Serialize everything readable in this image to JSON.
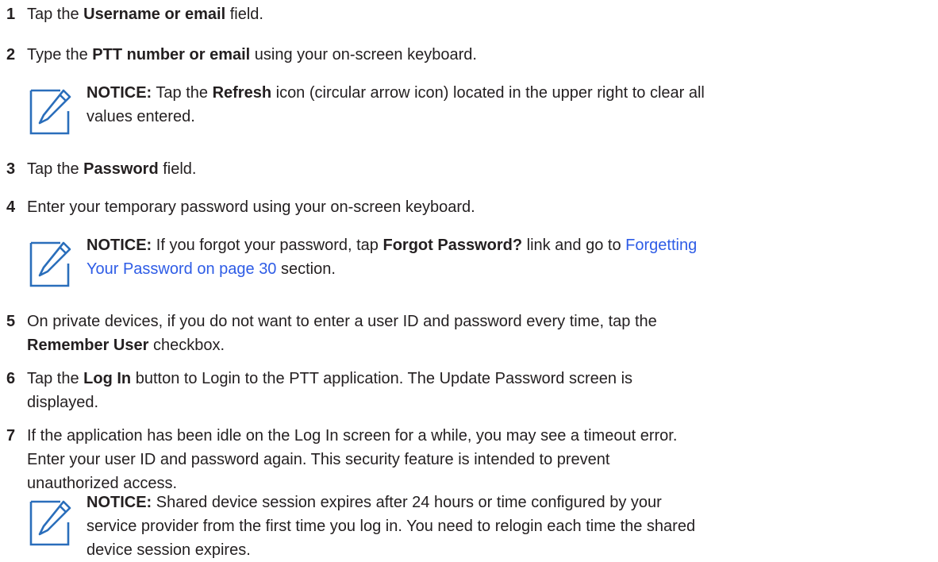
{
  "steps": [
    {
      "num": "1",
      "pre": "Tap the ",
      "bold": "Username or email",
      "post": " field."
    },
    {
      "num": "2",
      "pre": "Type the ",
      "bold": "PTT number or email",
      "post": " using your on-screen keyboard."
    },
    {
      "num": "3",
      "pre": "Tap the ",
      "bold": "Password",
      "post": " field."
    },
    {
      "num": "4",
      "text": "Enter your temporary password using your on-screen keyboard."
    },
    {
      "num": "5",
      "line1": "On private devices, if you do not want to enter a user ID and password every time, tap the",
      "bold": "Remember User",
      "post": " checkbox."
    },
    {
      "num": "6",
      "pre": "Tap the ",
      "bold": "Log In",
      "post": " button to Login to the PTT application. The Update Password screen is",
      "line2": "displayed."
    },
    {
      "num": "7",
      "line1": "If the application has been idle on the Log In screen for a while, you may see a timeout error.",
      "line2": "Enter your user ID and password again. This security feature is intended to prevent",
      "line3": "unauthorized access."
    }
  ],
  "notices": [
    {
      "label": "NOTICE:",
      "pre": " Tap the ",
      "bold": "Refresh",
      "post": " icon (circular arrow icon) located in the upper right to clear all",
      "line2": "values entered."
    },
    {
      "label": "NOTICE:",
      "pre": " If you forgot your password, tap ",
      "bold": "Forgot Password?",
      "mid": " link and go to ",
      "link1": "Forgetting",
      "link2": "Your Password on page 30",
      "post": " section."
    },
    {
      "label": "NOTICE:",
      "line1": " Shared device session expires after 24 hours or time configured by your",
      "line2": "service provider from the first time you log in. You need to relogin each time the shared",
      "line3": "device session expires."
    }
  ],
  "colors": {
    "text": "#231f20",
    "link": "#2e5ce6",
    "icon": "#2a6ebb"
  },
  "icons": {
    "notice": "pencil-note-icon"
  }
}
